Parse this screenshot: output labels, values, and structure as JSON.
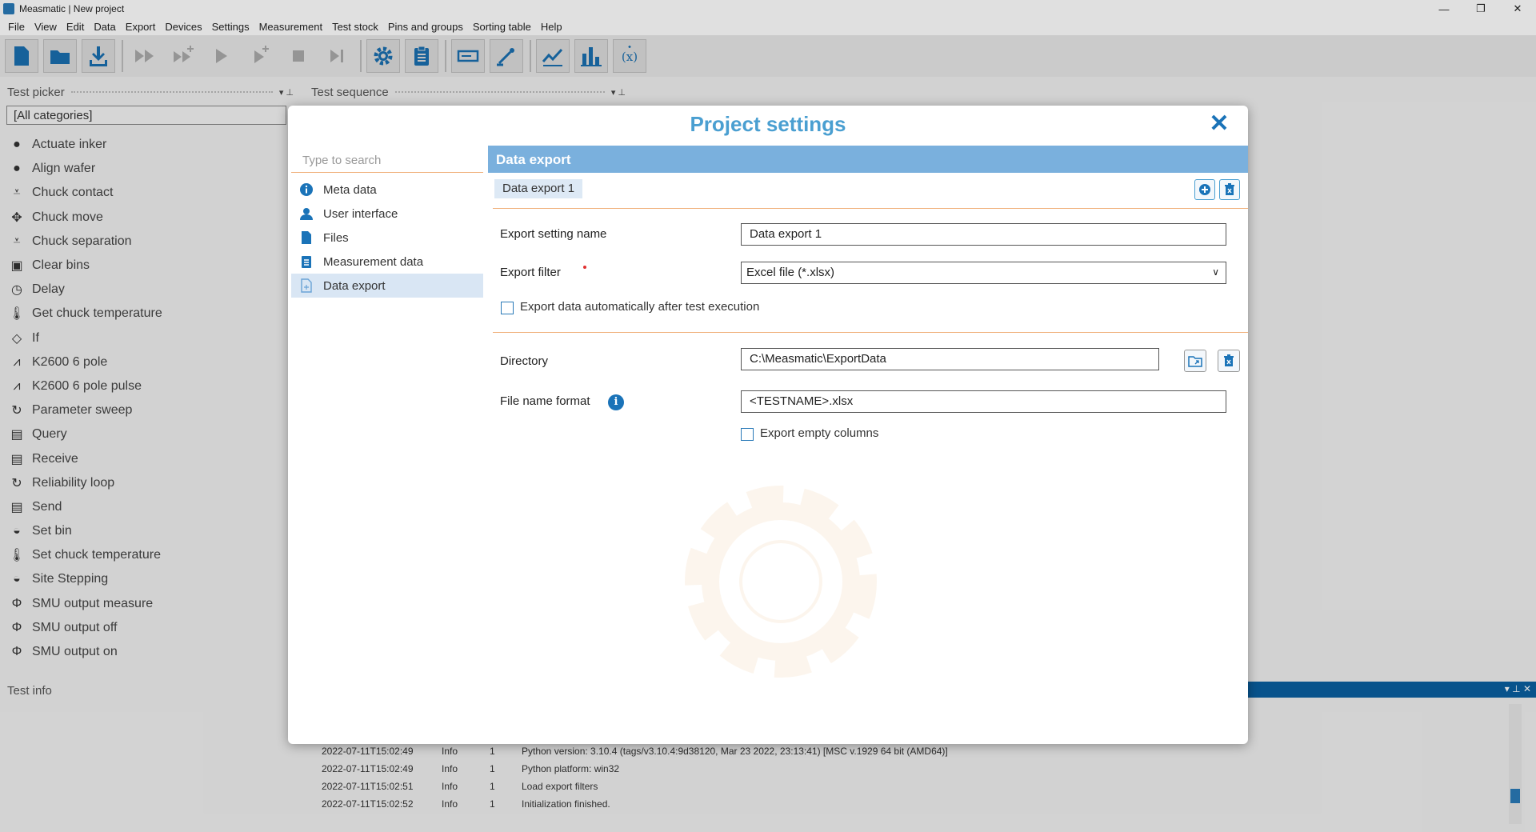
{
  "window": {
    "title": "Measmatic | New project",
    "controls": [
      "—",
      "❐",
      "✕"
    ]
  },
  "menu": [
    "File",
    "View",
    "Edit",
    "Data",
    "Export",
    "Devices",
    "Settings",
    "Measurement",
    "Test stock",
    "Pins and groups",
    "Sorting table",
    "Help"
  ],
  "toolbar": {
    "icons": [
      "new-file-icon",
      "open-folder-icon",
      "save-download-icon",
      "fast-forward-icon",
      "fast-forward-plus-icon",
      "play-icon",
      "play-step-icon",
      "stop-icon",
      "skip-end-icon",
      "gear-icon",
      "clipboard-icon",
      "device-icon",
      "probe-icon",
      "line-chart-icon",
      "bar-chart-icon",
      "function-icon"
    ]
  },
  "left_panel": {
    "test_picker_title": "Test picker",
    "test_sequence_title": "Test sequence",
    "category_value": "[All categories]",
    "tests": [
      "Actuate inker",
      "Align wafer",
      "Chuck contact",
      "Chuck move",
      "Chuck separation",
      "Clear bins",
      "Delay",
      "Get chuck temperature",
      "If",
      "K2600 6 pole",
      "K2600 6 pole pulse",
      "Parameter sweep",
      "Query",
      "Receive",
      "Reliability loop",
      "Send",
      "Set bin",
      "Set chuck temperature",
      "Site Stepping",
      "SMU output measure",
      "SMU output off",
      "SMU output on"
    ],
    "test_info_title": "Test info"
  },
  "log": {
    "rows": [
      {
        "time": "2022-07-11T15:02:49",
        "level": "Info",
        "id": "1",
        "message": "Python version: 3.10.4 (tags/v3.10.4:9d38120, Mar 23 2022, 23:13:41) [MSC v.1929 64 bit (AMD64)]"
      },
      {
        "time": "2022-07-11T15:02:49",
        "level": "Info",
        "id": "1",
        "message": "Python platform: win32"
      },
      {
        "time": "2022-07-11T15:02:51",
        "level": "Info",
        "id": "1",
        "message": "Load export filters"
      },
      {
        "time": "2022-07-11T15:02:52",
        "level": "Info",
        "id": "1",
        "message": "Initialization finished."
      }
    ]
  },
  "dialog": {
    "title": "Project settings",
    "close": "✕",
    "search_placeholder": "Type to search",
    "nav": [
      {
        "label": "Meta data",
        "icon": "info-icon"
      },
      {
        "label": "User interface",
        "icon": "user-icon"
      },
      {
        "label": "Files",
        "icon": "file-icon"
      },
      {
        "label": "Measurement data",
        "icon": "clipboard-icon"
      },
      {
        "label": "Data export",
        "icon": "export-file-icon",
        "selected": true
      }
    ],
    "section_title": "Data export",
    "tab_label": "Data export 1",
    "form": {
      "name_label": "Export setting name",
      "name_value": "Data export 1",
      "filter_label": "Export filter",
      "filter_value": "Excel file (*.xlsx)",
      "auto_export_label": "Export data automatically after test execution",
      "auto_export_checked": false,
      "directory_label": "Directory",
      "directory_value": "C:\\Measmatic\\ExportData",
      "filename_label": "File name format",
      "filename_value": "<TESTNAME>.xlsx",
      "empty_columns_label": "Export empty columns",
      "empty_columns_checked": false
    }
  }
}
